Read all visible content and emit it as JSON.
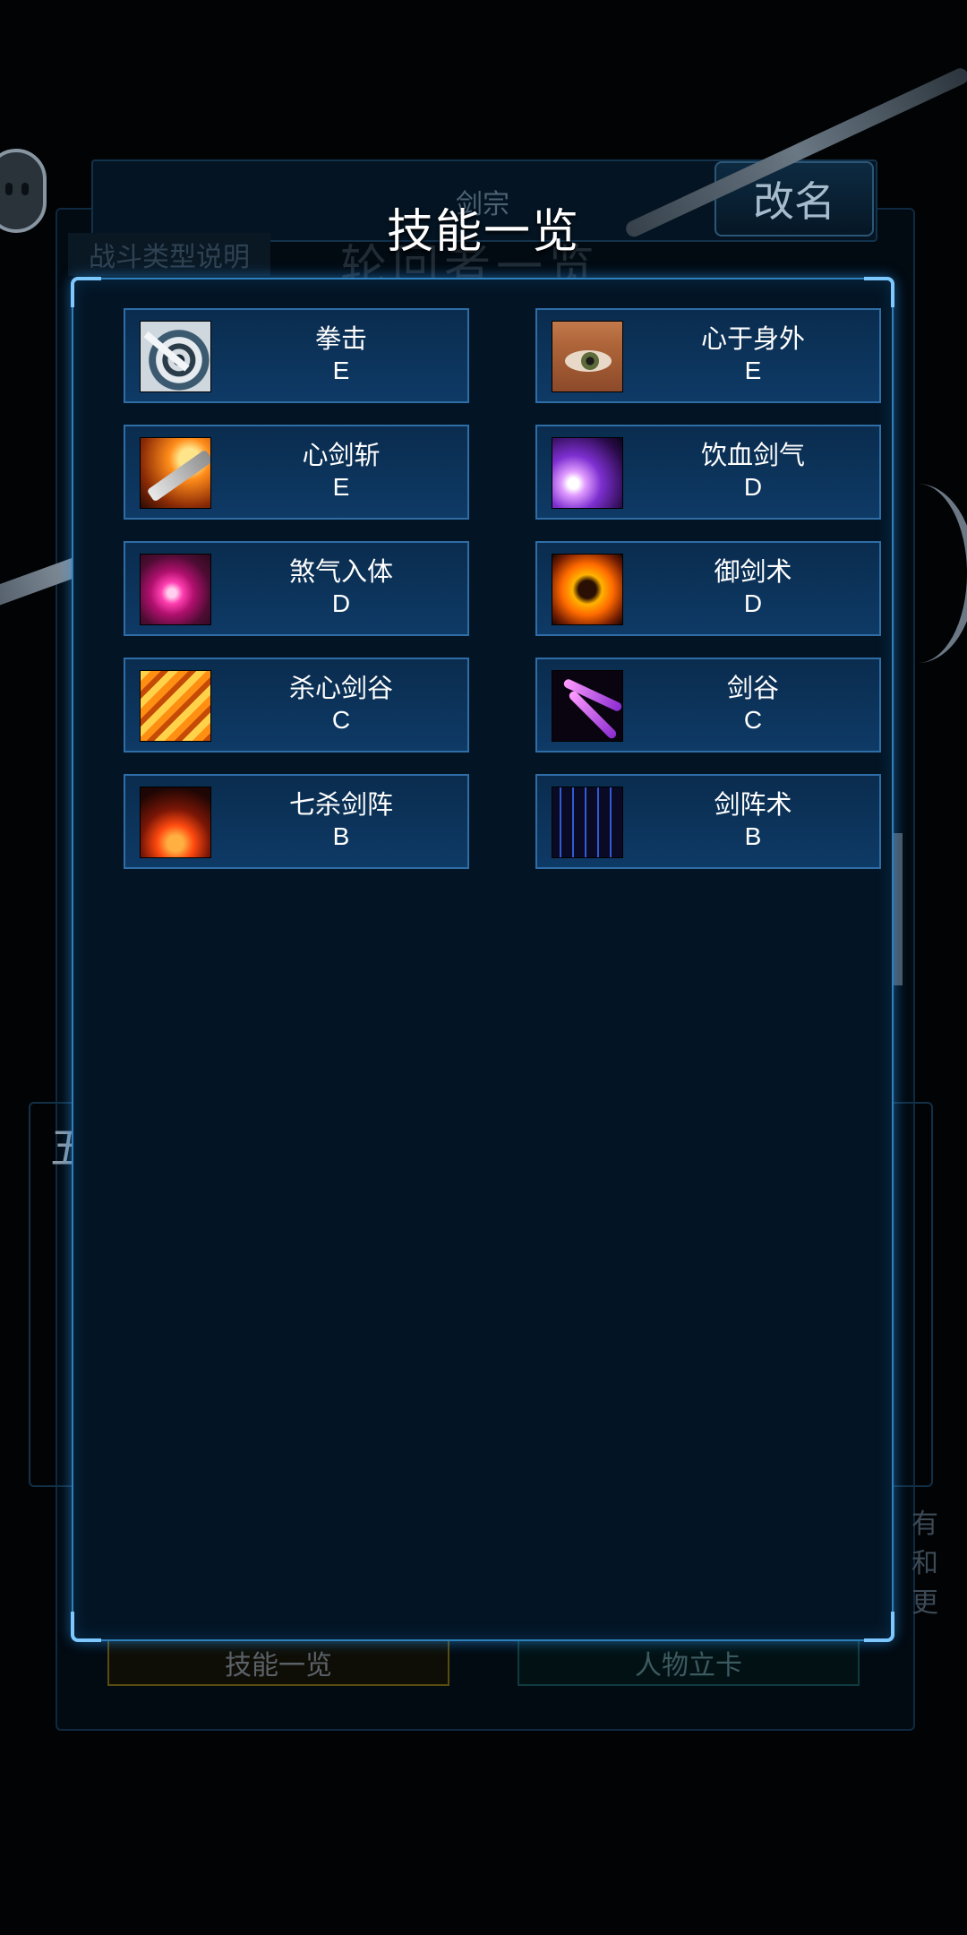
{
  "background": {
    "sect": "剑宗",
    "rename_label": "改名",
    "combat_type_tab": "战斗类型说明",
    "character_name": "轮回者一览",
    "section_char": "五",
    "side_text": "有和更",
    "bottom_left_button": "技能一览",
    "bottom_right_button": "人物立卡"
  },
  "modal": {
    "title": "技能一览",
    "skills": [
      {
        "name": "拳击",
        "grade": "E",
        "icon": "target-icon"
      },
      {
        "name": "心于身外",
        "grade": "E",
        "icon": "eye-icon"
      },
      {
        "name": "心剑斩",
        "grade": "E",
        "icon": "flaming-blade-icon"
      },
      {
        "name": "饮血剑气",
        "grade": "D",
        "icon": "purple-slash-icon"
      },
      {
        "name": "煞气入体",
        "grade": "D",
        "icon": "pink-orb-icon"
      },
      {
        "name": "御剑术",
        "grade": "D",
        "icon": "flame-silhouette-icon"
      },
      {
        "name": "杀心剑谷",
        "grade": "C",
        "icon": "fire-streaks-icon"
      },
      {
        "name": "剑谷",
        "grade": "C",
        "icon": "purple-claws-icon"
      },
      {
        "name": "七杀剑阵",
        "grade": "B",
        "icon": "lava-icon"
      },
      {
        "name": "剑阵术",
        "grade": "B",
        "icon": "sword-array-icon"
      }
    ]
  },
  "colors": {
    "modal_border": "#2f7fbb",
    "card_fill": "#0e3a66",
    "card_border": "#2f6da6",
    "modal_bg": "#031525"
  }
}
